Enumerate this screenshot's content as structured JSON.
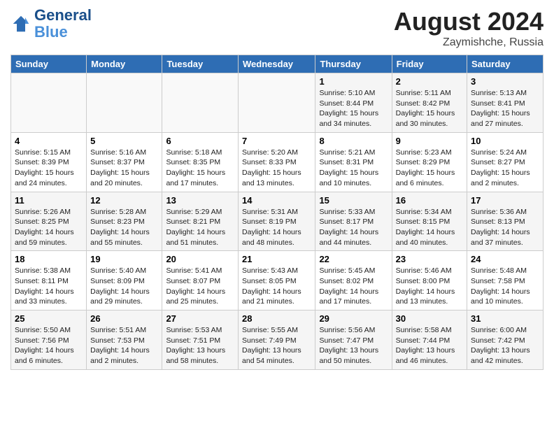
{
  "header": {
    "logo_line1": "General",
    "logo_line2": "Blue",
    "month_year": "August 2024",
    "location": "Zaymishche, Russia"
  },
  "days_of_week": [
    "Sunday",
    "Monday",
    "Tuesday",
    "Wednesday",
    "Thursday",
    "Friday",
    "Saturday"
  ],
  "weeks": [
    [
      {
        "day": "",
        "info": ""
      },
      {
        "day": "",
        "info": ""
      },
      {
        "day": "",
        "info": ""
      },
      {
        "day": "",
        "info": ""
      },
      {
        "day": "1",
        "info": "Sunrise: 5:10 AM\nSunset: 8:44 PM\nDaylight: 15 hours and 34 minutes."
      },
      {
        "day": "2",
        "info": "Sunrise: 5:11 AM\nSunset: 8:42 PM\nDaylight: 15 hours and 30 minutes."
      },
      {
        "day": "3",
        "info": "Sunrise: 5:13 AM\nSunset: 8:41 PM\nDaylight: 15 hours and 27 minutes."
      }
    ],
    [
      {
        "day": "4",
        "info": "Sunrise: 5:15 AM\nSunset: 8:39 PM\nDaylight: 15 hours and 24 minutes."
      },
      {
        "day": "5",
        "info": "Sunrise: 5:16 AM\nSunset: 8:37 PM\nDaylight: 15 hours and 20 minutes."
      },
      {
        "day": "6",
        "info": "Sunrise: 5:18 AM\nSunset: 8:35 PM\nDaylight: 15 hours and 17 minutes."
      },
      {
        "day": "7",
        "info": "Sunrise: 5:20 AM\nSunset: 8:33 PM\nDaylight: 15 hours and 13 minutes."
      },
      {
        "day": "8",
        "info": "Sunrise: 5:21 AM\nSunset: 8:31 PM\nDaylight: 15 hours and 10 minutes."
      },
      {
        "day": "9",
        "info": "Sunrise: 5:23 AM\nSunset: 8:29 PM\nDaylight: 15 hours and 6 minutes."
      },
      {
        "day": "10",
        "info": "Sunrise: 5:24 AM\nSunset: 8:27 PM\nDaylight: 15 hours and 2 minutes."
      }
    ],
    [
      {
        "day": "11",
        "info": "Sunrise: 5:26 AM\nSunset: 8:25 PM\nDaylight: 14 hours and 59 minutes."
      },
      {
        "day": "12",
        "info": "Sunrise: 5:28 AM\nSunset: 8:23 PM\nDaylight: 14 hours and 55 minutes."
      },
      {
        "day": "13",
        "info": "Sunrise: 5:29 AM\nSunset: 8:21 PM\nDaylight: 14 hours and 51 minutes."
      },
      {
        "day": "14",
        "info": "Sunrise: 5:31 AM\nSunset: 8:19 PM\nDaylight: 14 hours and 48 minutes."
      },
      {
        "day": "15",
        "info": "Sunrise: 5:33 AM\nSunset: 8:17 PM\nDaylight: 14 hours and 44 minutes."
      },
      {
        "day": "16",
        "info": "Sunrise: 5:34 AM\nSunset: 8:15 PM\nDaylight: 14 hours and 40 minutes."
      },
      {
        "day": "17",
        "info": "Sunrise: 5:36 AM\nSunset: 8:13 PM\nDaylight: 14 hours and 37 minutes."
      }
    ],
    [
      {
        "day": "18",
        "info": "Sunrise: 5:38 AM\nSunset: 8:11 PM\nDaylight: 14 hours and 33 minutes."
      },
      {
        "day": "19",
        "info": "Sunrise: 5:40 AM\nSunset: 8:09 PM\nDaylight: 14 hours and 29 minutes."
      },
      {
        "day": "20",
        "info": "Sunrise: 5:41 AM\nSunset: 8:07 PM\nDaylight: 14 hours and 25 minutes."
      },
      {
        "day": "21",
        "info": "Sunrise: 5:43 AM\nSunset: 8:05 PM\nDaylight: 14 hours and 21 minutes."
      },
      {
        "day": "22",
        "info": "Sunrise: 5:45 AM\nSunset: 8:02 PM\nDaylight: 14 hours and 17 minutes."
      },
      {
        "day": "23",
        "info": "Sunrise: 5:46 AM\nSunset: 8:00 PM\nDaylight: 14 hours and 13 minutes."
      },
      {
        "day": "24",
        "info": "Sunrise: 5:48 AM\nSunset: 7:58 PM\nDaylight: 14 hours and 10 minutes."
      }
    ],
    [
      {
        "day": "25",
        "info": "Sunrise: 5:50 AM\nSunset: 7:56 PM\nDaylight: 14 hours and 6 minutes."
      },
      {
        "day": "26",
        "info": "Sunrise: 5:51 AM\nSunset: 7:53 PM\nDaylight: 14 hours and 2 minutes."
      },
      {
        "day": "27",
        "info": "Sunrise: 5:53 AM\nSunset: 7:51 PM\nDaylight: 13 hours and 58 minutes."
      },
      {
        "day": "28",
        "info": "Sunrise: 5:55 AM\nSunset: 7:49 PM\nDaylight: 13 hours and 54 minutes."
      },
      {
        "day": "29",
        "info": "Sunrise: 5:56 AM\nSunset: 7:47 PM\nDaylight: 13 hours and 50 minutes."
      },
      {
        "day": "30",
        "info": "Sunrise: 5:58 AM\nSunset: 7:44 PM\nDaylight: 13 hours and 46 minutes."
      },
      {
        "day": "31",
        "info": "Sunrise: 6:00 AM\nSunset: 7:42 PM\nDaylight: 13 hours and 42 minutes."
      }
    ]
  ]
}
